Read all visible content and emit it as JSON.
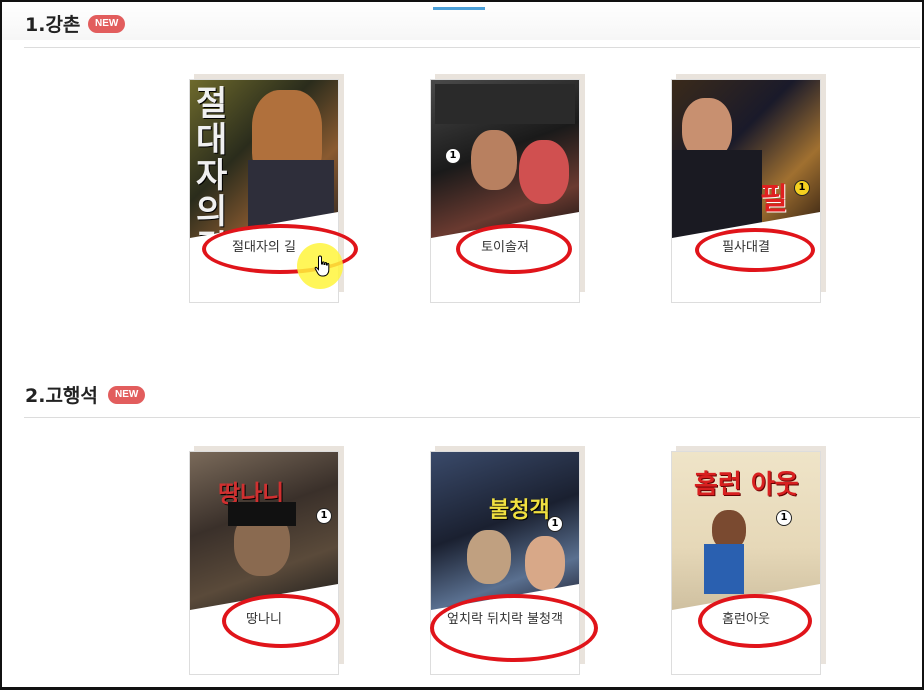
{
  "sections": [
    {
      "title": "1.강촌",
      "badge": "NEW",
      "books": [
        {
          "title": "절대자의 길",
          "cover_text": "절대자의길",
          "cover_colors": [
            "#7a6a2a",
            "#2a2a1a",
            "#c88840"
          ]
        },
        {
          "title": "토이솔져",
          "cover_text": "",
          "cover_colors": [
            "#3a3a3a",
            "#111111",
            "#b87060"
          ]
        },
        {
          "title": "필사대결",
          "cover_text": "필",
          "cover_colors": [
            "#5a3a2a",
            "#1a1a2a",
            "#d0a060"
          ]
        }
      ]
    },
    {
      "title": "2.고행석",
      "badge": "NEW",
      "books": [
        {
          "title": "땅나니",
          "cover_text": "땅나니",
          "cover_colors": [
            "#6a5040",
            "#2a2020",
            "#a08060"
          ]
        },
        {
          "title": "엎치락 뒤치락 불청객",
          "cover_text": "불청객",
          "cover_colors": [
            "#2a3a5a",
            "#1a2030",
            "#6080a0"
          ]
        },
        {
          "title": "홈런아웃",
          "cover_text": "홈런 아웃",
          "cover_colors": [
            "#e8dcc0",
            "#c8b890",
            "#3060a0"
          ]
        }
      ]
    }
  ],
  "accent_color": "#e25d5d",
  "annotation_color": "#e0141a",
  "tab_indicator_color": "#4a9fd8"
}
